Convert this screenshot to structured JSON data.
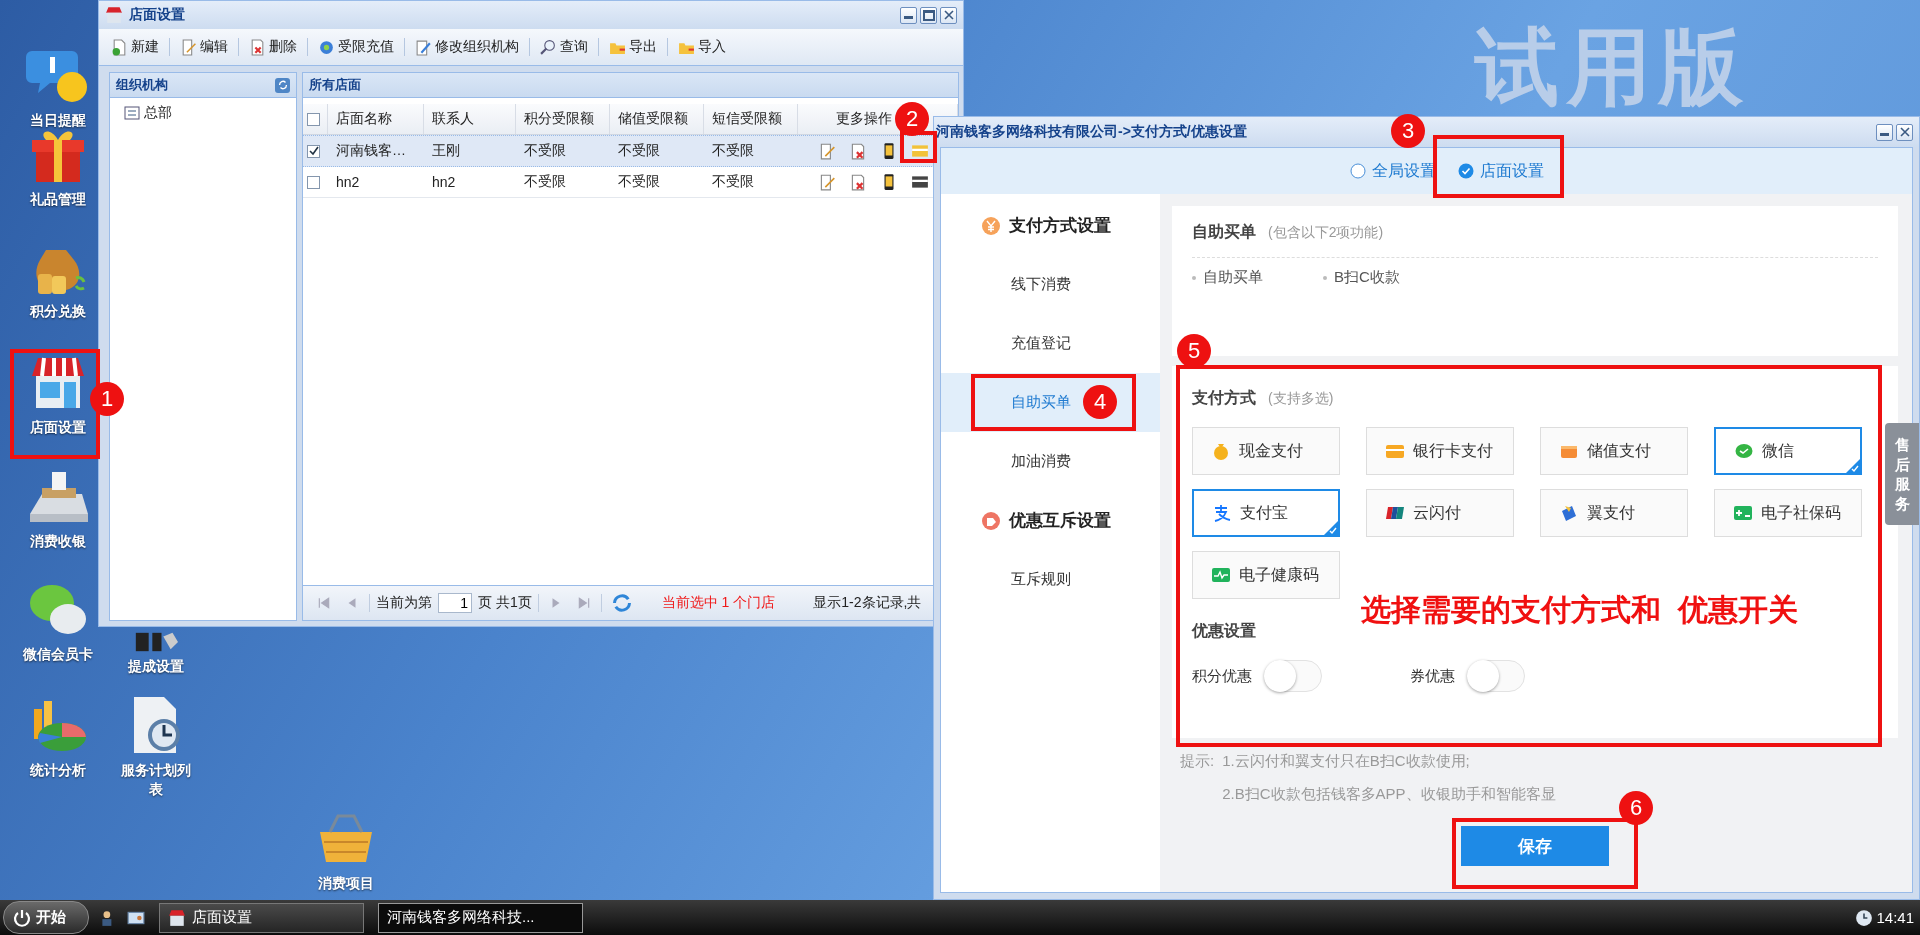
{
  "desktop": {
    "wallpaper_text": "试用版",
    "icons": [
      {
        "label": "当日提醒",
        "kind": "reminder"
      },
      {
        "label": "礼品管理",
        "kind": "gift"
      },
      {
        "label": "积分兑换",
        "kind": "money"
      },
      {
        "label": "店面设置",
        "kind": "store"
      },
      {
        "label": "消费收银",
        "kind": "register"
      },
      {
        "label": "微信会员卡",
        "kind": "wechat"
      },
      {
        "label": "提成设置",
        "kind": "commission"
      },
      {
        "label": "统计分析",
        "kind": "chart"
      },
      {
        "label": "服务计划列表",
        "kind": "schedule"
      },
      {
        "label": "消费项目",
        "kind": "basket"
      }
    ]
  },
  "store_window": {
    "title": "店面设置",
    "toolbar": [
      {
        "label": "新建",
        "kind": "new"
      },
      {
        "label": "编辑",
        "kind": "edit"
      },
      {
        "label": "删除",
        "kind": "delete"
      },
      {
        "label": "受限充值",
        "kind": "recharge"
      },
      {
        "label": "修改组织机构",
        "kind": "org"
      },
      {
        "label": "查询",
        "kind": "search"
      },
      {
        "label": "导出",
        "kind": "export"
      },
      {
        "label": "导入",
        "kind": "import"
      }
    ],
    "org_panel": {
      "title": "组织机构",
      "tree": [
        {
          "label": "总部"
        }
      ]
    },
    "stores_panel": {
      "title": "所有店面",
      "all_checked": false,
      "columns": [
        "店面名称",
        "联系人",
        "积分受限额",
        "储值受限额",
        "短信受限额",
        "更多操作"
      ],
      "rows": [
        {
          "selected": true,
          "cells": [
            "河南钱客…",
            "王刚",
            "不受限",
            "不受限",
            "不受限"
          ]
        },
        {
          "selected": false,
          "cells": [
            "hn2",
            "hn2",
            "不受限",
            "不受限",
            "不受限"
          ]
        }
      ]
    },
    "pager": {
      "prefix": "当前为第",
      "page": "1",
      "suffix": "页 共1页",
      "selection": "当前选中 1 个门店",
      "summary": "显示1-2条记录,共"
    }
  },
  "dialog": {
    "title": "河南钱客多网络科技有限公司->支付方式/优惠设置",
    "scope_options": [
      {
        "label": "全局设置",
        "selected": false
      },
      {
        "label": "店面设置",
        "selected": true
      }
    ],
    "nav": [
      {
        "kind": "group",
        "label": "支付方式设置"
      },
      {
        "kind": "item",
        "label": "线下消费",
        "selected": false
      },
      {
        "kind": "item",
        "label": "充值登记",
        "selected": false
      },
      {
        "kind": "item",
        "label": "自助买单",
        "selected": true
      },
      {
        "kind": "item",
        "label": "加油消费",
        "selected": false
      },
      {
        "kind": "group",
        "label": "优惠互斥设置"
      },
      {
        "kind": "item",
        "label": "互斥规则",
        "selected": false
      }
    ],
    "feature": {
      "title": "自助买单",
      "note": "(包含以下2项功能)",
      "items": [
        "自助买单",
        "B扫C收款"
      ]
    },
    "payments": {
      "title": "支付方式",
      "note": "(支持多选)",
      "options": [
        {
          "label": "现金支付",
          "selected": false
        },
        {
          "label": "银行卡支付",
          "selected": false
        },
        {
          "label": "储值支付",
          "selected": false
        },
        {
          "label": "微信",
          "selected": true
        },
        {
          "label": "支付宝",
          "selected": true
        },
        {
          "label": "云闪付",
          "selected": false
        },
        {
          "label": "翼支付",
          "selected": false
        },
        {
          "label": "电子社保码",
          "selected": false
        },
        {
          "label": "电子健康码",
          "selected": false
        }
      ]
    },
    "discounts": {
      "title": "优惠设置",
      "toggles": [
        {
          "label": "积分优惠",
          "on": false
        },
        {
          "label": "券优惠",
          "on": false
        }
      ]
    },
    "tips": {
      "label": "提示:",
      "lines": [
        "1.云闪付和翼支付只在B扫C收款使用;",
        "2.B扫C收款包括钱客多APP、收银助手和智能客显"
      ]
    },
    "save": "保存",
    "side_tab": "售后服务"
  },
  "annotations": {
    "markers": [
      "1",
      "2",
      "3",
      "4",
      "5",
      "6"
    ],
    "callout": "选择需要的支付方式和  优惠开关"
  },
  "taskbar": {
    "start": "开始",
    "tasks": [
      {
        "label": "店面设置",
        "selected": false
      },
      {
        "label": "河南钱客多网络科技...",
        "selected": true
      }
    ],
    "clock": "14:41"
  }
}
